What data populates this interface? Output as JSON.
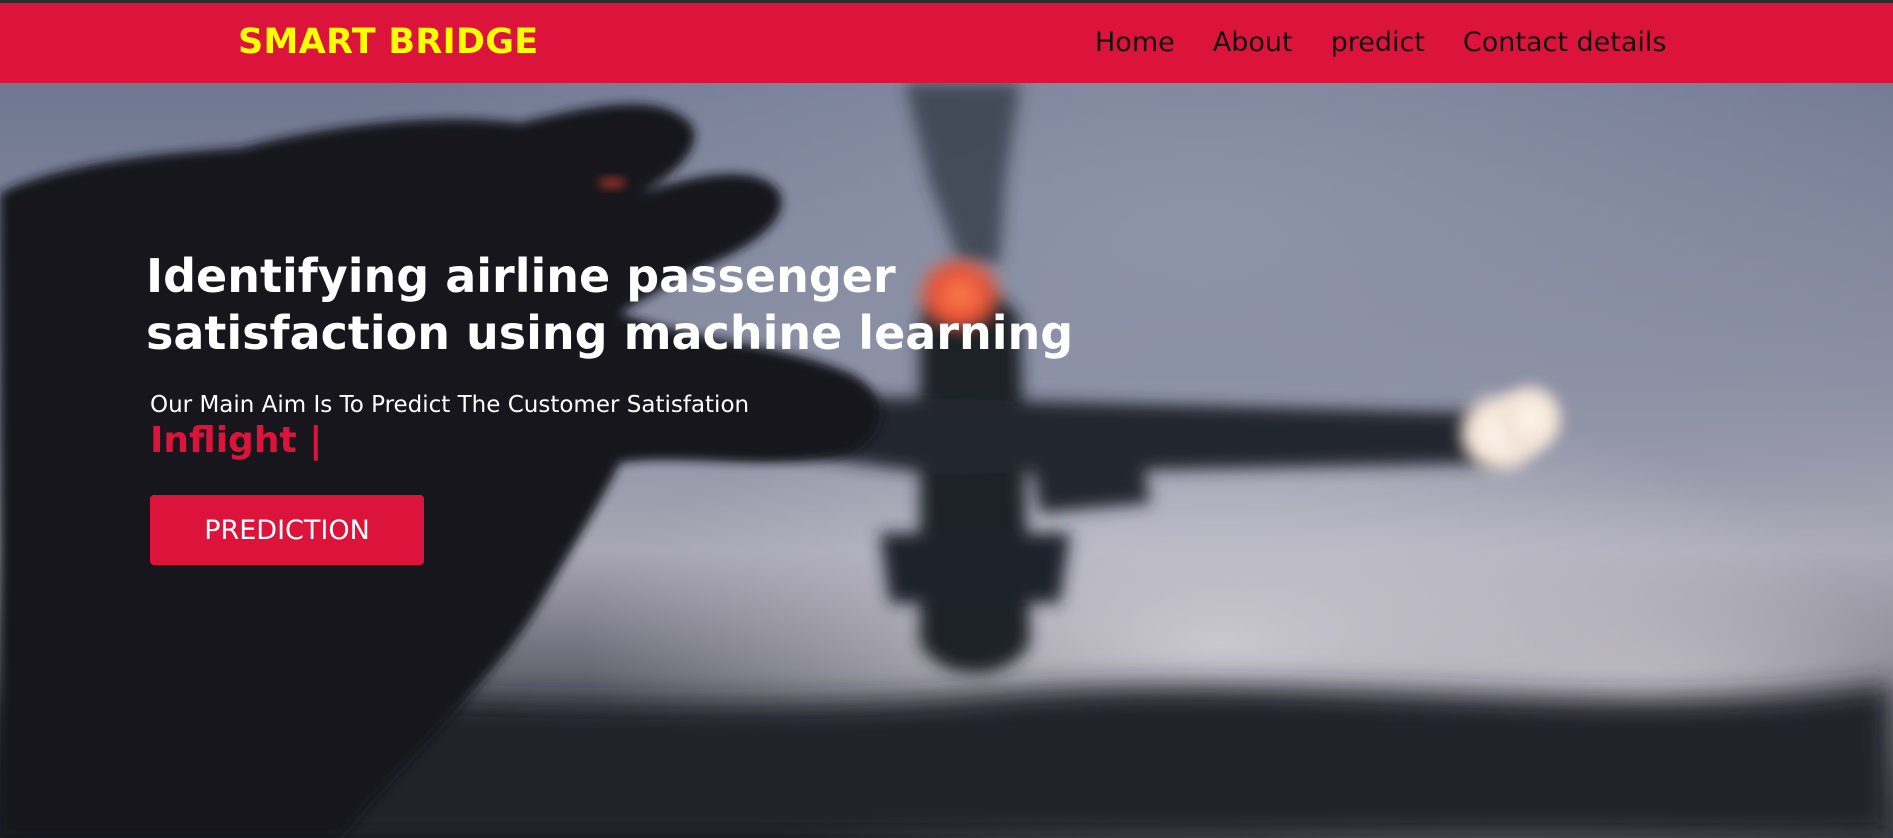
{
  "header": {
    "brand": "SMART BRIDGE",
    "nav": [
      {
        "label": "Home"
      },
      {
        "label": "About"
      },
      {
        "label": "predict"
      },
      {
        "label": "Contact details"
      }
    ]
  },
  "hero": {
    "title": "Identifying airline passenger satisfaction using machine learning",
    "subtitle": "Our Main Aim Is To Predict The Customer Satisfation",
    "typing_text": "Inflight |",
    "cta_label": "PREDICTION"
  },
  "colors": {
    "nav_background": "#dc143c",
    "brand_text": "#ffff00",
    "nav_text": "#111111",
    "accent": "#dc143c",
    "hero_text": "#ffffff"
  }
}
